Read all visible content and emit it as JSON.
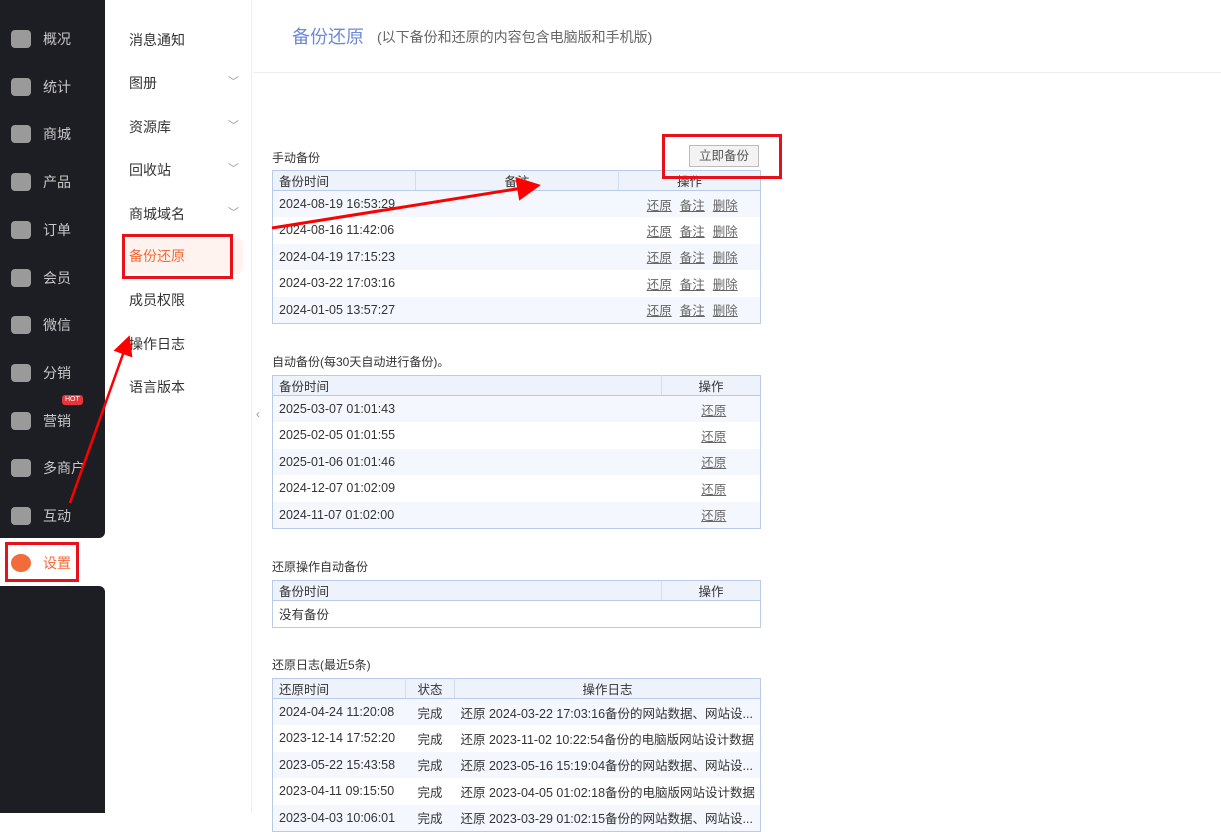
{
  "sidebar": {
    "items": [
      {
        "label": "概况",
        "icon": "layers-icon"
      },
      {
        "label": "统计",
        "icon": "chart-icon"
      },
      {
        "label": "商城",
        "icon": "shop-bag-icon"
      },
      {
        "label": "产品",
        "icon": "grid-icon"
      },
      {
        "label": "订单",
        "icon": "clipboard-icon"
      },
      {
        "label": "会员",
        "icon": "crown-icon"
      },
      {
        "label": "微信",
        "icon": "wechat-icon"
      },
      {
        "label": "分销",
        "icon": "users-icon"
      },
      {
        "label": "营销",
        "icon": "flag-icon",
        "badge": "HOT"
      },
      {
        "label": "多商户",
        "icon": "store-plus-icon"
      },
      {
        "label": "互动",
        "icon": "interact-icon"
      },
      {
        "label": "设置",
        "icon": "gear-icon",
        "active": true
      }
    ]
  },
  "submenu": {
    "items": [
      {
        "label": "消息通知"
      },
      {
        "label": "图册"
      },
      {
        "label": "资源库"
      },
      {
        "label": "回收站"
      },
      {
        "label": "商城域名"
      },
      {
        "label": "备份还原"
      },
      {
        "label": "成员权限"
      },
      {
        "label": "操作日志"
      },
      {
        "label": "语言版本"
      }
    ]
  },
  "header": {
    "title": "备份还原",
    "subtitle": "(以下备份和还原的内容包含电脑版和手机版)"
  },
  "manual": {
    "title": "手动备份",
    "button": "立即备份",
    "headers": [
      "备份时间",
      "备注",
      "操作"
    ],
    "actions": [
      "还原",
      "备注",
      "删除"
    ],
    "rows": [
      "2024-08-19 16:53:29",
      "2024-08-16 11:42:06",
      "2024-04-19 17:15:23",
      "2024-03-22 17:03:16",
      "2024-01-05 13:57:27"
    ]
  },
  "auto": {
    "title": "自动备份(每30天自动进行备份)。",
    "headers": [
      "备份时间",
      "操作"
    ],
    "action": "还原",
    "rows": [
      "2025-03-07 01:01:43",
      "2025-02-05 01:01:55",
      "2025-01-06 01:01:46",
      "2024-12-07 01:02:09",
      "2024-11-07 01:02:00"
    ]
  },
  "restore_auto": {
    "title": "还原操作自动备份",
    "headers": [
      "备份时间",
      "操作"
    ],
    "empty": "没有备份"
  },
  "log": {
    "title": "还原日志(最近5条)",
    "headers": [
      "还原时间",
      "状态",
      "操作日志"
    ],
    "rows": [
      [
        "2024-04-24 11:20:08",
        "完成",
        "还原 2024-03-22 17:03:16备份的网站数据、网站设..."
      ],
      [
        "2023-12-14 17:52:20",
        "完成",
        "还原 2023-11-02 10:22:54备份的电脑版网站设计数据"
      ],
      [
        "2023-05-22 15:43:58",
        "完成",
        "还原 2023-05-16 15:19:04备份的网站数据、网站设..."
      ],
      [
        "2023-04-11 09:15:50",
        "完成",
        "还原 2023-04-05 01:02:18备份的电脑版网站设计数据"
      ],
      [
        "2023-04-03 10:06:01",
        "完成",
        "还原 2023-03-29 01:02:15备份的网站数据、网站设..."
      ]
    ]
  }
}
